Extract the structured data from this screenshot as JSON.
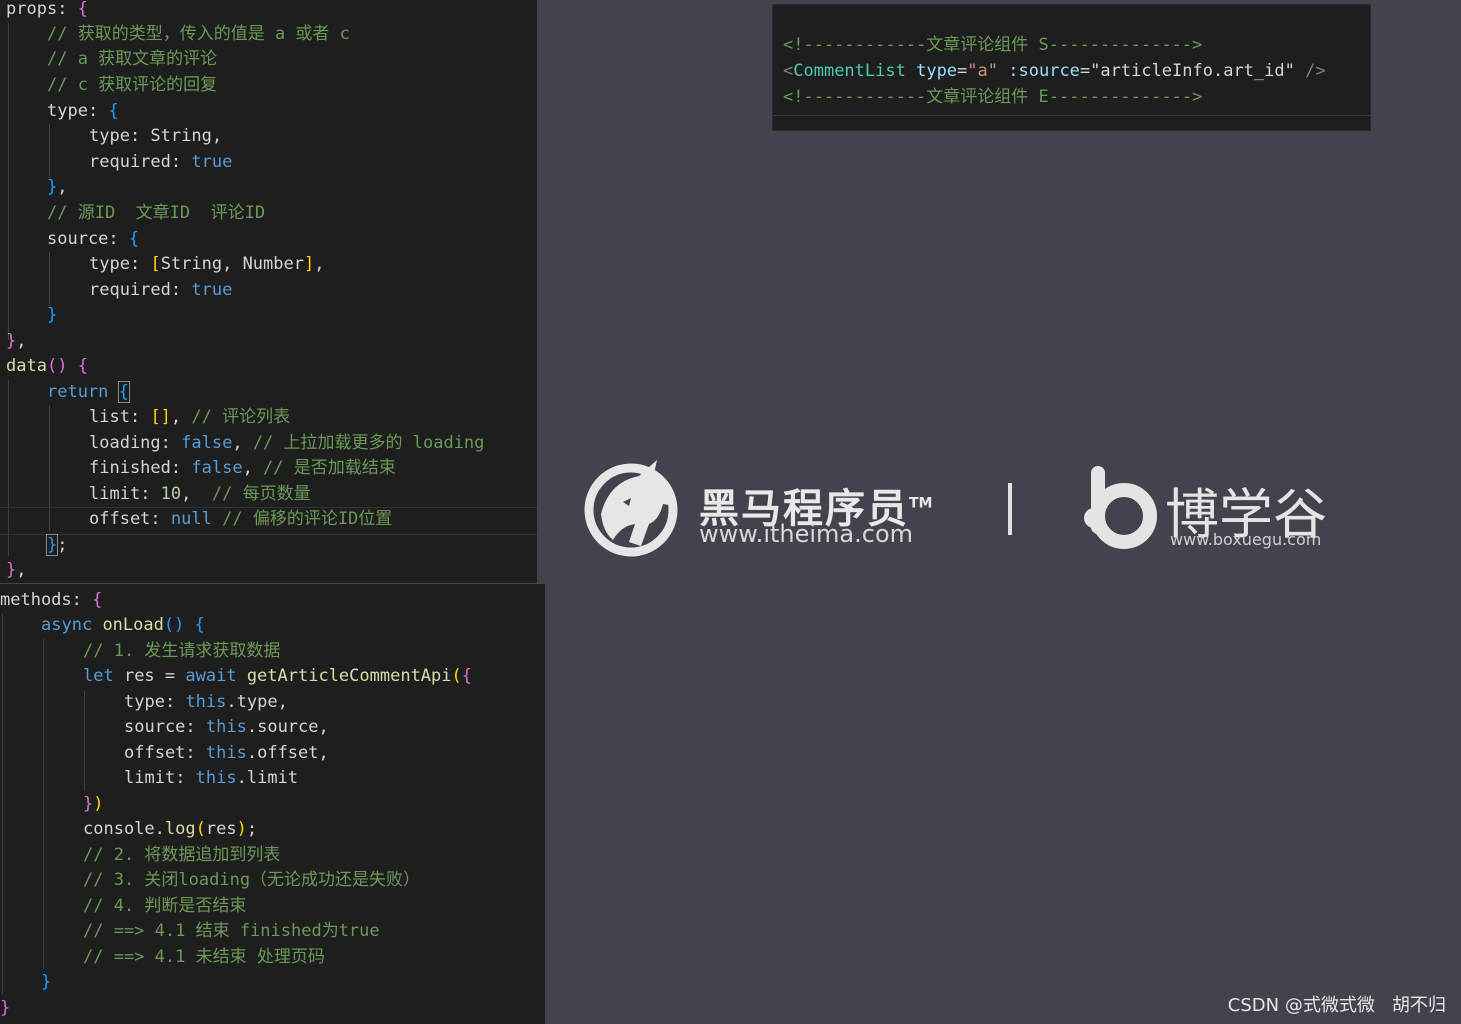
{
  "editor": {
    "props_panel": {
      "lines": [
        {
          "s": "props"
        },
        {
          "p": ": "
        },
        {
          "b1": "{"
        },
        {
          "c": "// 获取的类型，传入的值是 a 或者 c"
        },
        {
          "c": "// a 获取文章的评论"
        },
        {
          "c": "// c 获取评论的回复"
        },
        {
          "t": "type"
        },
        {
          "p": ": "
        },
        {
          "b2": "{"
        },
        {
          "t": "type"
        },
        {
          "p": ": String,"
        },
        {
          "t": "required"
        },
        {
          "p": ": "
        },
        {
          "k": "true"
        },
        {
          "b2": "}"
        },
        {
          "p": ","
        },
        {
          "c": "// 源ID  文章ID  评论ID"
        },
        {
          "t": "source"
        },
        {
          "p": ": "
        },
        {
          "b2": "{"
        },
        {
          "t": "type"
        },
        {
          "p": ": "
        },
        {
          "b3": "["
        },
        {
          "p": "String, Number"
        },
        {
          "b3": "]"
        },
        {
          "p": ","
        },
        {
          "t": "required"
        },
        {
          "p": ": "
        },
        {
          "k": "true"
        },
        {
          "b2": "}"
        },
        {
          "b1": "}"
        },
        {
          "p": ","
        },
        {
          "t": "data"
        },
        {
          "b1": "()"
        },
        {
          "p": " "
        },
        {
          "b1": "{"
        },
        {
          "k": "return"
        },
        {
          "p": " "
        },
        {
          "b2": "{"
        },
        {
          "t": "list"
        },
        {
          "p": ": "
        },
        {
          "b3": "[]"
        },
        {
          "p": ", "
        },
        {
          "c": "// 评论列表"
        },
        {
          "t": "loading"
        },
        {
          "p": ": "
        },
        {
          "k": "false"
        },
        {
          "p": ", "
        },
        {
          "c": "// 上拉加载更多的 loading"
        },
        {
          "t": "finished"
        },
        {
          "p": ": "
        },
        {
          "k": "false"
        },
        {
          "p": ", "
        },
        {
          "c": "// 是否加载结束"
        },
        {
          "t": "limit"
        },
        {
          "p": ": "
        },
        {
          "n": "10"
        },
        {
          "p": ",  "
        },
        {
          "c": "// 每页数量"
        },
        {
          "t": "offset"
        },
        {
          "p": ": "
        },
        {
          "k": "null"
        },
        {
          "p": " "
        },
        {
          "c": "// 偏移的评论ID位置"
        },
        {
          "b2": "}"
        },
        {
          "p": ";"
        },
        {
          "b1": "}"
        },
        {
          "p": ","
        }
      ]
    },
    "methods_panel": {
      "lines": [
        {
          "t": "methods"
        },
        {
          "p": ": "
        },
        {
          "b1": "{"
        },
        {
          "k": "async"
        },
        {
          "p": " "
        },
        {
          "f": "onLoad"
        },
        {
          "b2": "()"
        },
        {
          "p": " "
        },
        {
          "b2": "{"
        },
        {
          "c": "// 1. 发生请求获取数据"
        },
        {
          "k": "let"
        },
        {
          "p": " res = "
        },
        {
          "k": "await"
        },
        {
          "p": " "
        },
        {
          "f": "getArticleCommentApi"
        },
        {
          "b3": "("
        },
        {
          "b1": "{"
        },
        {
          "t": "type"
        },
        {
          "p": ": "
        },
        {
          "k": "this"
        },
        {
          "p": ".type,"
        },
        {
          "t": "source"
        },
        {
          "p": ": "
        },
        {
          "k": "this"
        },
        {
          "p": ".source,"
        },
        {
          "t": "offset"
        },
        {
          "p": ": "
        },
        {
          "k": "this"
        },
        {
          "p": ".offset,"
        },
        {
          "t": "limit"
        },
        {
          "p": ": "
        },
        {
          "k": "this"
        },
        {
          "p": ".limit"
        },
        {
          "b1": "}"
        },
        {
          "b3": ")"
        },
        {
          "t": "console"
        },
        {
          "p": "."
        },
        {
          "f": "log"
        },
        {
          "b3": "("
        },
        {
          "p": "res"
        },
        {
          "b3": ")"
        },
        {
          "p": ";"
        },
        {
          "c": "// 2. 将数据追加到列表"
        },
        {
          "c": "// 3. 关闭loading（无论成功还是失败）"
        },
        {
          "c": "// 4. 判断是否结束"
        },
        {
          "c": "// ==> 4.1 结束 finished为true"
        },
        {
          "c": "// ==> 4.1 未结束 处理页码"
        },
        {
          "b2": "}"
        },
        {
          "b1": "}"
        }
      ]
    },
    "template_panel": {
      "lines": [
        {
          "c": "<!------------文章评论组件 S-------------->"
        },
        {
          "g": "<"
        },
        {
          "tg": "CommentList"
        },
        {
          "p": " "
        },
        {
          "a": "type"
        },
        {
          "p": "="
        },
        {
          "st": "\"a\""
        },
        {
          "p": " "
        },
        {
          "a": ":source"
        },
        {
          "p": "=\"articleInfo.art_id\""
        },
        {
          "p": " "
        },
        {
          "g": "/>"
        },
        {
          "c": "<!------------文章评论组件 E-------------->"
        }
      ]
    }
  },
  "branding": {
    "heima_name": "黑马程序员",
    "heima_tm": "TM",
    "heima_url": "www.itheima.com",
    "boxuegu_name": "博学谷",
    "boxuegu_url": "www.boxuegu.com"
  },
  "watermark": "CSDN @式微式微   胡不归",
  "colors": {
    "editor_bg": "#1e1e1e",
    "page_bg": "#41444d",
    "comment": "#6a9955",
    "keyword": "#569cd6",
    "bracket_1": "#da70d6",
    "bracket_2": "#179fff",
    "bracket_3": "#ffd700"
  },
  "icons": [
    "heima-horse-logo-icon",
    "boxuegu-b-logo-icon"
  ]
}
